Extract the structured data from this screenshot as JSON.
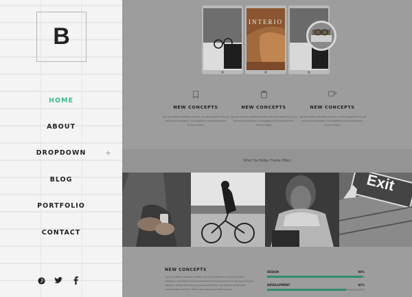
{
  "logo": {
    "letter": "B"
  },
  "nav": {
    "items": [
      {
        "label": "HOME",
        "active": true
      },
      {
        "label": "ABOUT",
        "active": false
      },
      {
        "label": "DROPDOWN",
        "active": false,
        "has_submenu": true
      },
      {
        "label": "BLOG",
        "active": false
      },
      {
        "label": "PORTFOLIO",
        "active": false
      },
      {
        "label": "CONTACT",
        "active": false
      }
    ],
    "submenu_icon": "+"
  },
  "social": [
    "pinterest-icon",
    "twitter-icon",
    "facebook-icon"
  ],
  "showcase": {
    "phone_text": "INTERIO"
  },
  "features": [
    {
      "icon": "bookmark-icon",
      "title": "NEW CONCEPTS",
      "text": "Typi non habent claritatem insitam; est usus legentis in iis qui facit eorum claritatem. Investigationes demonstraverunt lectores legere"
    },
    {
      "icon": "clipboard-icon",
      "title": "NEW CONCEPTS",
      "text": "Typi non habent claritatem insitam; est usus legentis in iis qui facit eorum claritatem. Investigationes demonstraverunt lectores legere"
    },
    {
      "icon": "cup-icon",
      "title": "NEW CONCEPTS",
      "text": "Typi non habent claritatem insitam; est usus legentis in iis qui facit eorum claritatem. Investigationes demonstraverunt lectores legere"
    }
  ],
  "band": {
    "text": "What The Bridge Theme Offers"
  },
  "photos": {
    "exit_sign": "Exit"
  },
  "bottom": {
    "title": "NEW CONCEPTS",
    "text": "Typi non habent claritatem insitam; est usus legentis in iis qui facit eorum claritatem. Investigationes demonstraverunt lectores legere me lius quod ii legunt saepius. Claritas est etiam processus dynamicus, qui sequitur mutationem consuetudium lectorum. Mirum est notare quam littera gothica"
  },
  "skills": [
    {
      "label": "DESIGN",
      "value": "98%",
      "percent": 98
    },
    {
      "label": "DEVELOPMENT",
      "value": "81%",
      "percent": 81
    }
  ],
  "colors": {
    "accent": "#3fb993",
    "bar_fill": "#2e8c6e"
  }
}
